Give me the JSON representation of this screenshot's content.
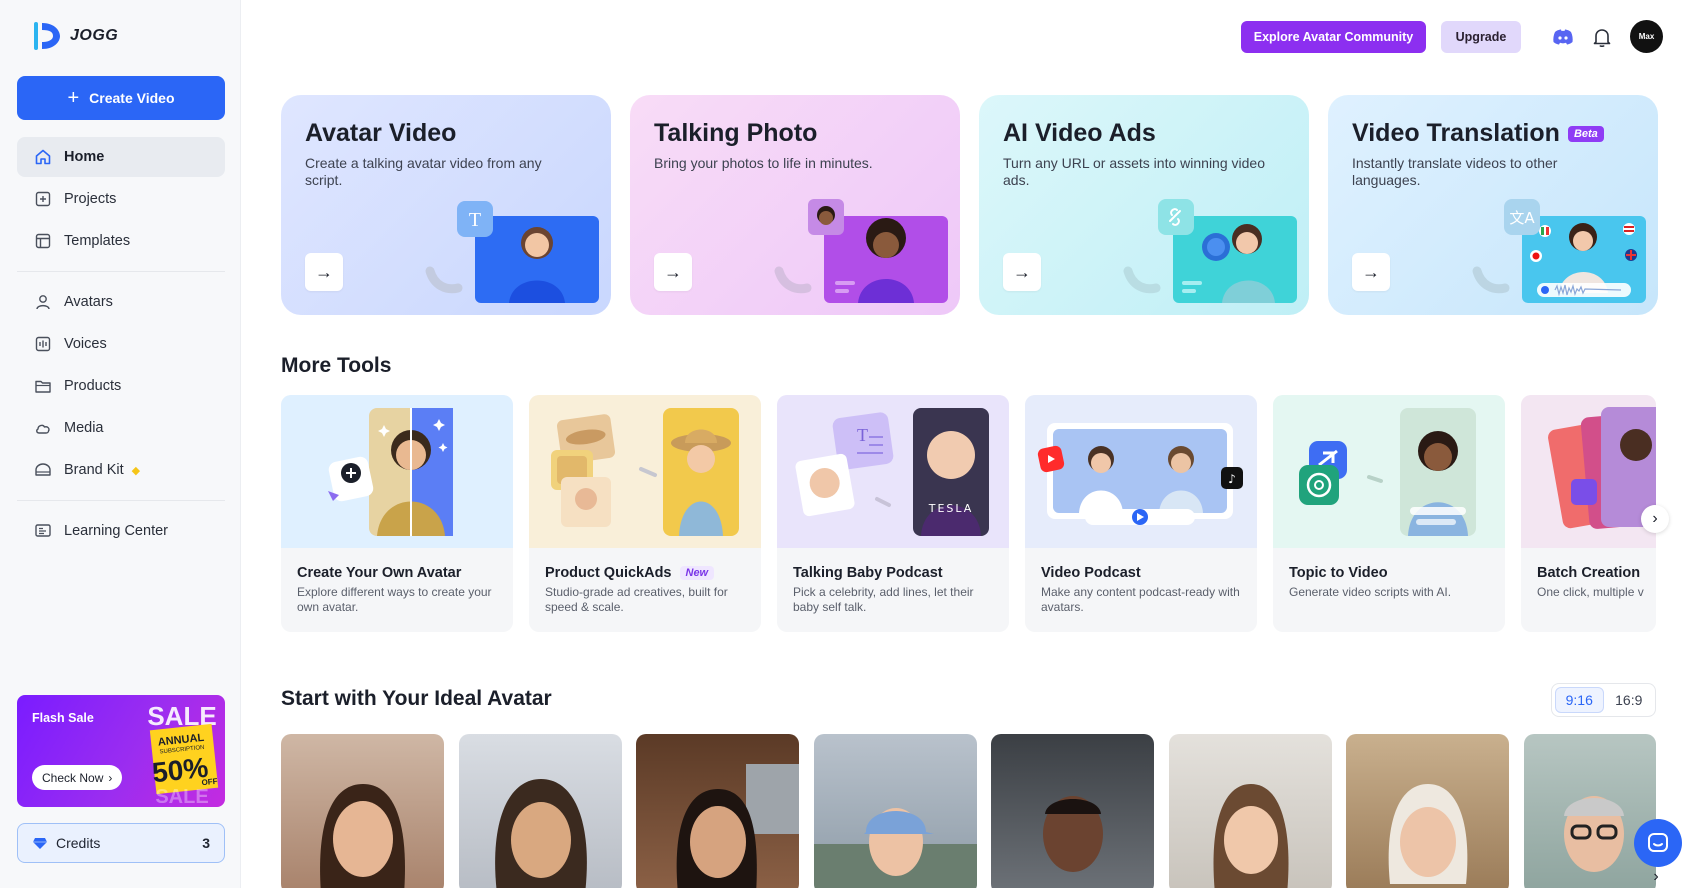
{
  "brand": {
    "name": "JOGG",
    "accent": "#2b66f6"
  },
  "sidebar": {
    "create_label": "Create Video",
    "items": [
      {
        "label": "Home",
        "icon": "home-icon",
        "active": true
      },
      {
        "label": "Projects",
        "icon": "projects-icon"
      },
      {
        "label": "Templates",
        "icon": "templates-icon"
      },
      {
        "label": "Avatars",
        "icon": "user-icon"
      },
      {
        "label": "Voices",
        "icon": "voice-icon"
      },
      {
        "label": "Products",
        "icon": "folder-icon"
      },
      {
        "label": "Media",
        "icon": "cloud-icon"
      },
      {
        "label": "Brand Kit",
        "icon": "brand-kit-icon"
      },
      {
        "label": "Learning Center",
        "icon": "learning-icon"
      }
    ],
    "flash_sale": {
      "title": "Flash Sale",
      "cta": "Check Now",
      "sale_text": "SALE",
      "annual": "ANNUAL",
      "subscription": "SUBSCRIPTION",
      "discount": "50%",
      "off": "OFF"
    },
    "credits": {
      "label": "Credits",
      "value": "3"
    }
  },
  "header": {
    "explore_label": "Explore Avatar Community",
    "upgrade_label": "Upgrade",
    "user_avatar_text": "Max"
  },
  "features": [
    {
      "title": "Avatar Video",
      "desc": "Create a talking avatar video from any script."
    },
    {
      "title": "Talking Photo",
      "desc": "Bring your photos to life in minutes."
    },
    {
      "title": "AI Video Ads",
      "desc": "Turn any URL or assets into winning video ads."
    },
    {
      "title": "Video Translation",
      "desc": "Instantly translate videos to other languages.",
      "badge": "Beta"
    }
  ],
  "more_tools": {
    "title": "More Tools",
    "items": [
      {
        "title": "Create Your Own Avatar",
        "desc": "Explore different ways to create your own avatar."
      },
      {
        "title": "Product QuickAds",
        "badge": "New",
        "desc": "Studio-grade ad creatives, built for speed & scale."
      },
      {
        "title": "Talking Baby Podcast",
        "desc": "Pick a celebrity, add lines, let their baby self talk."
      },
      {
        "title": "Video Podcast",
        "desc": "Make any content podcast-ready with avatars."
      },
      {
        "title": "Topic to Video",
        "desc": "Generate video scripts with AI."
      },
      {
        "title": "Batch Creation",
        "desc": "One click, multiple v"
      }
    ]
  },
  "ideal_avatar": {
    "title": "Start with Your Ideal Avatar",
    "ratios": [
      "9:16",
      "16:9"
    ],
    "selected_ratio": "9:16"
  },
  "misc": {
    "tesla_text": "TESLA"
  }
}
